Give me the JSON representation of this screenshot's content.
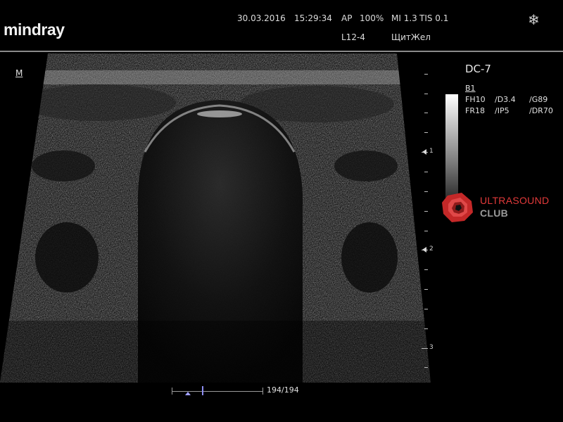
{
  "header": {
    "brand": "mindray",
    "date": "30.03.2016",
    "time": "15:29:34",
    "ap": "AP",
    "ap_value": "100%",
    "mi": "MI 1.3",
    "tis": "TIS 0.1",
    "probe": "L12-4",
    "preset": "ЩитЖел",
    "freeze_icon": "snowflake-icon"
  },
  "image": {
    "orientation_mark": "M",
    "depth_labels": [
      "1",
      "2",
      "3"
    ]
  },
  "params": {
    "model": "DC-7",
    "mode": "B1",
    "fh": "FH10",
    "d": "/D3.4",
    "g": "/G89",
    "fr": "FR18",
    "ip": "/IP5",
    "dr": "/DR70"
  },
  "watermark": {
    "line1": "ULTRASOUND",
    "line2": "CLUB",
    "color": "#e23a3a"
  },
  "cine": {
    "frame_counter": "194/194"
  }
}
